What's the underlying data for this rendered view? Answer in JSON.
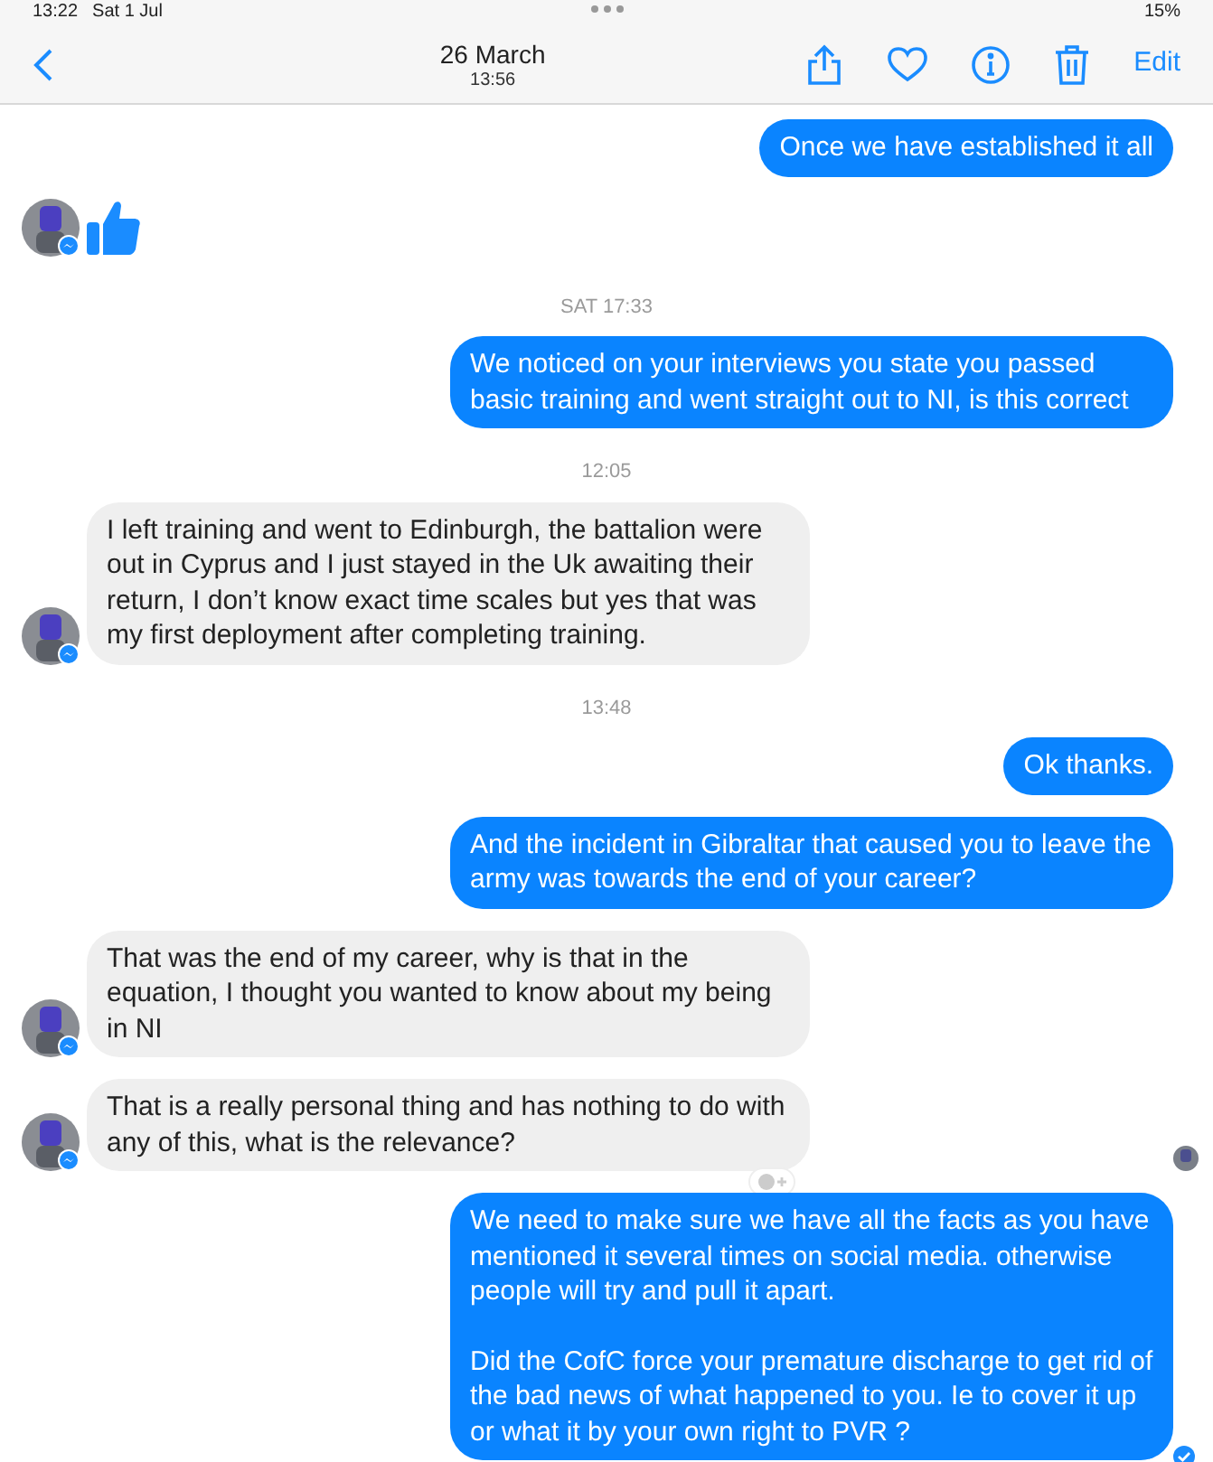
{
  "status_bar": {
    "time": "13:22",
    "date": "Sat 1 Jul",
    "battery": "15%"
  },
  "header": {
    "title": "26 March",
    "subtitle": "13:56",
    "edit": "Edit"
  },
  "messages": [
    {
      "kind": "sent",
      "paragraphs": [
        "Once we have established it all"
      ]
    },
    {
      "kind": "like",
      "avatar": true
    },
    {
      "kind": "timestamp",
      "text": "SAT 17:33"
    },
    {
      "kind": "sent",
      "paragraphs": [
        "We noticed on your interviews you state you passed basic training and went straight out to NI, is this correct"
      ]
    },
    {
      "kind": "timestamp",
      "text": "12:05"
    },
    {
      "kind": "received",
      "avatar": true,
      "paragraphs": [
        "I left training and went to Edinburgh, the battalion were out in Cyprus and I just stayed in the Uk awaiting their return, I don’t know exact time scales but yes that was my first deployment after completing training."
      ]
    },
    {
      "kind": "timestamp",
      "text": "13:48"
    },
    {
      "kind": "sent",
      "paragraphs": [
        "Ok thanks."
      ]
    },
    {
      "kind": "sent",
      "paragraphs": [
        "And the incident in Gibraltar that caused you to leave the army was towards the end of your career?"
      ]
    },
    {
      "kind": "received",
      "avatar": true,
      "paragraphs": [
        "That was the end of my career, why is that in the equation, I thought you wanted to know about my being in NI"
      ]
    },
    {
      "kind": "received",
      "avatar": true,
      "reaction_button": true,
      "seen_avatar": true,
      "paragraphs": [
        "That is a really personal thing and has nothing to do with any of this, what is the relevance?"
      ]
    },
    {
      "kind": "sent",
      "delivered": true,
      "paragraphs": [
        "We need to make sure we have all the facts as you have mentioned it several times on social media. otherwise people will try and pull it apart.",
        "Did the CofC force your premature discharge to get rid of the bad news of what happened to you. Ie to cover it up or what it by your own right to PVR ?"
      ]
    }
  ]
}
